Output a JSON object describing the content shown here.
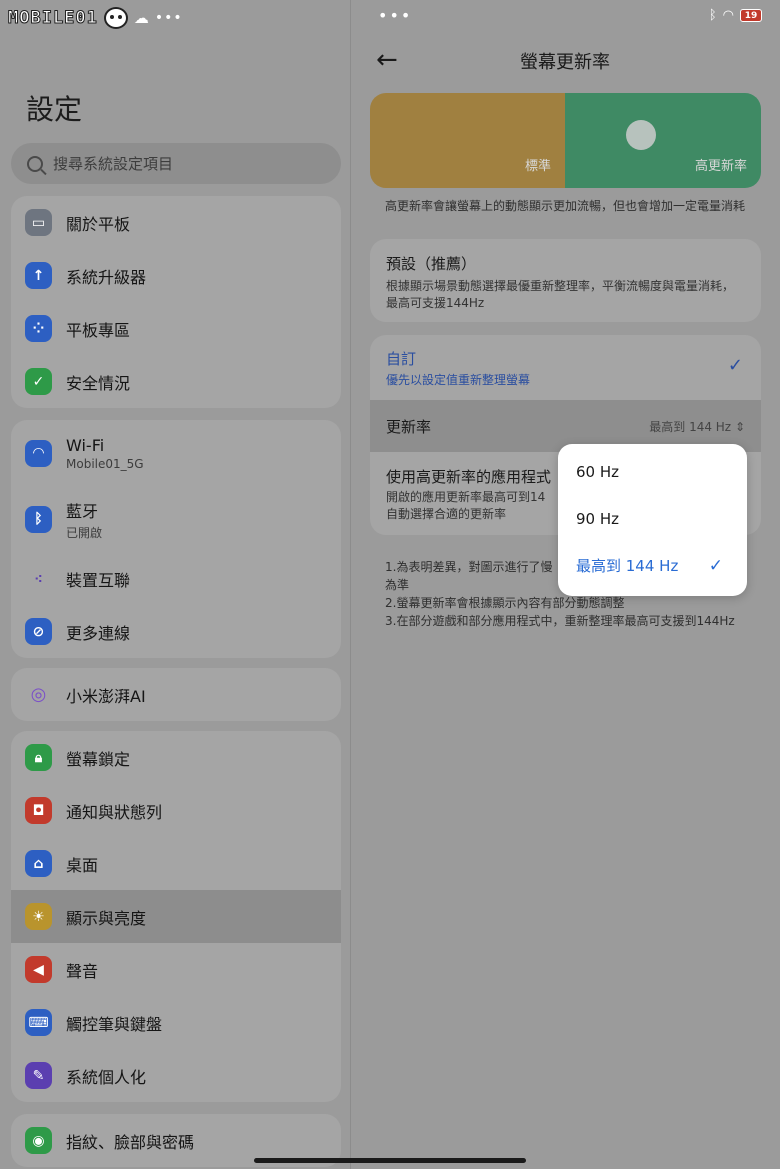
{
  "status_bar": {
    "watermark": "MOBILE01",
    "right_battery": "19"
  },
  "left": {
    "title": "設定",
    "search_placeholder": "搜尋系統設定項目",
    "groups": [
      {
        "items": [
          {
            "label": "關於平板",
            "icon": "tablet-icon",
            "color": "gray"
          },
          {
            "label": "系統升級器",
            "icon": "upgrade-arrow-icon",
            "color": "blue"
          },
          {
            "label": "平板專區",
            "icon": "grid-dots-icon",
            "color": "blue"
          },
          {
            "label": "安全情況",
            "icon": "shield-check-icon",
            "color": "green"
          }
        ]
      },
      {
        "items": [
          {
            "label": "Wi-Fi",
            "sub": "Mobile01_5G",
            "icon": "wifi-icon",
            "color": "blue"
          },
          {
            "label": "藍牙",
            "sub": "已開啟",
            "icon": "bluetooth-icon",
            "color": "blue"
          },
          {
            "label": "裝置互聯",
            "icon": "device-link-icon",
            "color": "none"
          },
          {
            "label": "更多連線",
            "icon": "link-icon",
            "color": "blue"
          }
        ]
      },
      {
        "items": [
          {
            "label": "小米澎湃AI",
            "icon": "ai-swirl-icon",
            "color": "none"
          }
        ]
      },
      {
        "items": [
          {
            "label": "螢幕鎖定",
            "icon": "lock-icon",
            "color": "green"
          },
          {
            "label": "通知與狀態列",
            "icon": "notification-icon",
            "color": "red"
          },
          {
            "label": "桌面",
            "icon": "home-icon",
            "color": "blue"
          },
          {
            "label": "顯示與亮度",
            "icon": "sun-icon",
            "color": "yellow"
          },
          {
            "label": "聲音",
            "icon": "speaker-icon",
            "color": "red"
          },
          {
            "label": "觸控筆與鍵盤",
            "icon": "keyboard-icon",
            "color": "blue"
          },
          {
            "label": "系統個人化",
            "icon": "brush-icon",
            "color": "purple"
          }
        ]
      },
      {
        "items": [
          {
            "label": "指紋、臉部與密碼",
            "icon": "fingerprint-icon",
            "color": "green"
          }
        ]
      }
    ]
  },
  "right": {
    "title": "螢幕更新率",
    "preview": {
      "left_label": "標準",
      "right_label": "高更新率"
    },
    "description": "高更新率會讓螢幕上的動態顯示更加流暢，但也會增加一定電量消耗",
    "default_option": {
      "title": "預設（推薦）",
      "sub": "根據顯示場景動態選擇最優重新整理率，平衡流暢度與電量消耗，最高可支援144Hz"
    },
    "custom_option": {
      "title": "自訂",
      "sub": "優先以設定值重新整理螢幕"
    },
    "rate_row": {
      "label": "更新率",
      "value": "最高到 144 Hz"
    },
    "apps_row": {
      "title": "使用高更新率的應用程式",
      "sub_1": "開啟的應用更新率最高可到14",
      "sub_2": "自動選擇合適的更新率"
    },
    "notes": [
      "1.為表明差異，對圖示進行了慢",
      "為準",
      "2.螢幕更新率會根據顯示內容有部分動態調整",
      "3.在部分遊戲和部分應用程式中，重新整理率最高可支援到144Hz"
    ],
    "dropdown": {
      "options": [
        "60 Hz",
        "90 Hz",
        "最高到 144 Hz"
      ],
      "selected": "最高到 144 Hz"
    }
  }
}
